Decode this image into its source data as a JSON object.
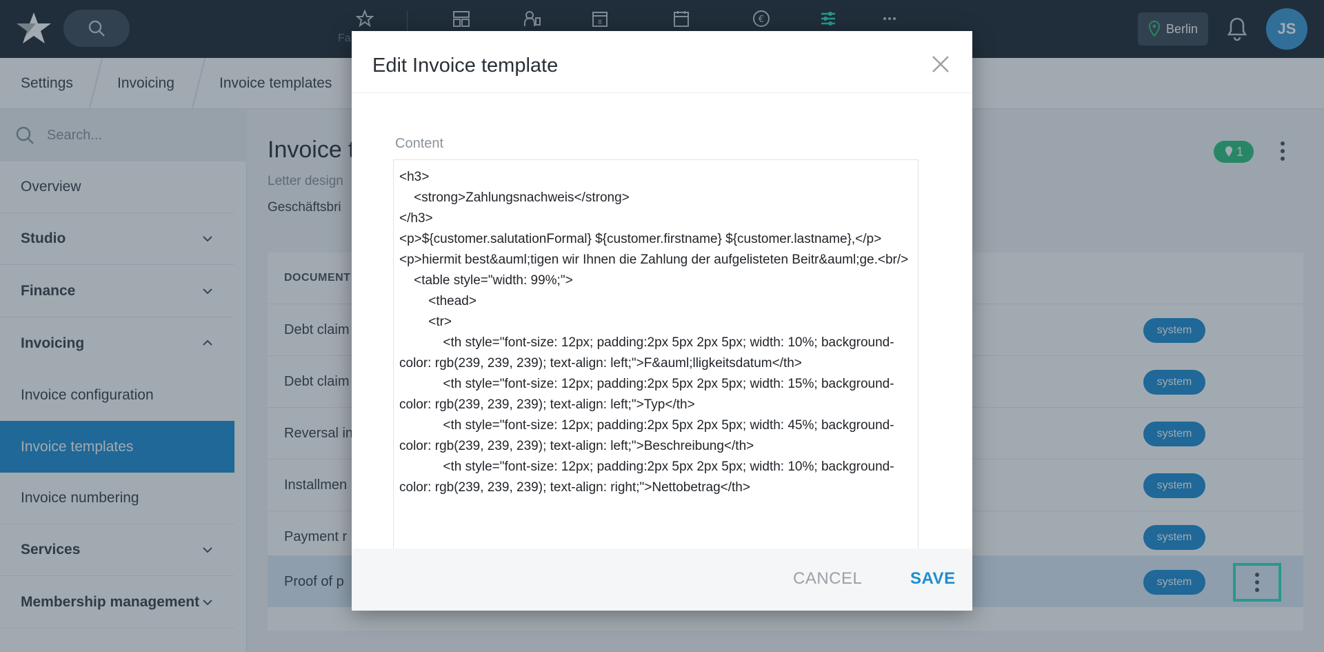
{
  "topbar": {
    "favorites_label": "Fa",
    "location_label": "Berlin",
    "avatar_initials": "JS",
    "nav_icons": [
      "star-icon",
      "dashboard-icon",
      "user-id-icon",
      "calendar-day-icon",
      "calendar-icon",
      "euro-icon",
      "settings-sliders-icon",
      "more-icon"
    ],
    "accent_color": "#2de0c2"
  },
  "breadcrumb": {
    "items": [
      "Settings",
      "Invoicing",
      "Invoice templates"
    ]
  },
  "sidebar": {
    "search_placeholder": "Search...",
    "items": [
      {
        "label": "Overview"
      },
      {
        "label": "Studio"
      },
      {
        "label": "Finance"
      },
      {
        "label": "Invoicing"
      },
      {
        "label": "Invoice configuration"
      },
      {
        "label": "Invoice templates"
      },
      {
        "label": "Invoice numbering"
      },
      {
        "label": "Services"
      },
      {
        "label": "Membership management"
      }
    ]
  },
  "main": {
    "title": "Invoice t",
    "subtitle1": "Letter design",
    "subtitle2": "Geschäftsbri",
    "pin_count": "1",
    "table_header": "DOCUMENT",
    "rows": [
      {
        "name": "Debt claim",
        "badge": "system"
      },
      {
        "name": "Debt claim",
        "badge": "system"
      },
      {
        "name": "Reversal in",
        "badge": "system"
      },
      {
        "name": "Installmen",
        "badge": "system"
      },
      {
        "name": "Payment r",
        "badge": "system"
      },
      {
        "name": "Proof of p",
        "badge": "system"
      }
    ]
  },
  "modal": {
    "title": "Edit Invoice template",
    "content_label": "Content",
    "content_lines": [
      "<h3>",
      "    <strong>Zahlungsnachweis</strong>",
      "</h3>",
      "<p>${customer.salutationFormal} ${customer.firstname} ${customer.lastname},</p>",
      "<p>hiermit best&auml;tigen wir Ihnen die Zahlung der aufgelisteten Beitr&auml;ge.<br/>",
      "    <table style=\"width: 99%;\">",
      "        <thead>",
      "        <tr>",
      "            <th style=\"font-size: 12px; padding:2px 5px 2px 5px; width: 10%; background-color: rgb(239, 239, 239); text-align: left;\">F&auml;lligkeitsdatum</th>",
      "            <th style=\"font-size: 12px; padding:2px 5px 2px 5px; width: 15%; background-color: rgb(239, 239, 239); text-align: left;\">Typ</th>",
      "            <th style=\"font-size: 12px; padding:2px 5px 2px 5px; width: 45%; background-color: rgb(239, 239, 239); text-align: left;\">Beschreibung</th>",
      "            <th style=\"font-size: 12px; padding:2px 5px 2px 5px; width: 10%; background-color: rgb(239, 239, 239); text-align: right;\">Nettobetrag</th>"
    ],
    "cancel_label": "CANCEL",
    "save_label": "SAVE"
  }
}
